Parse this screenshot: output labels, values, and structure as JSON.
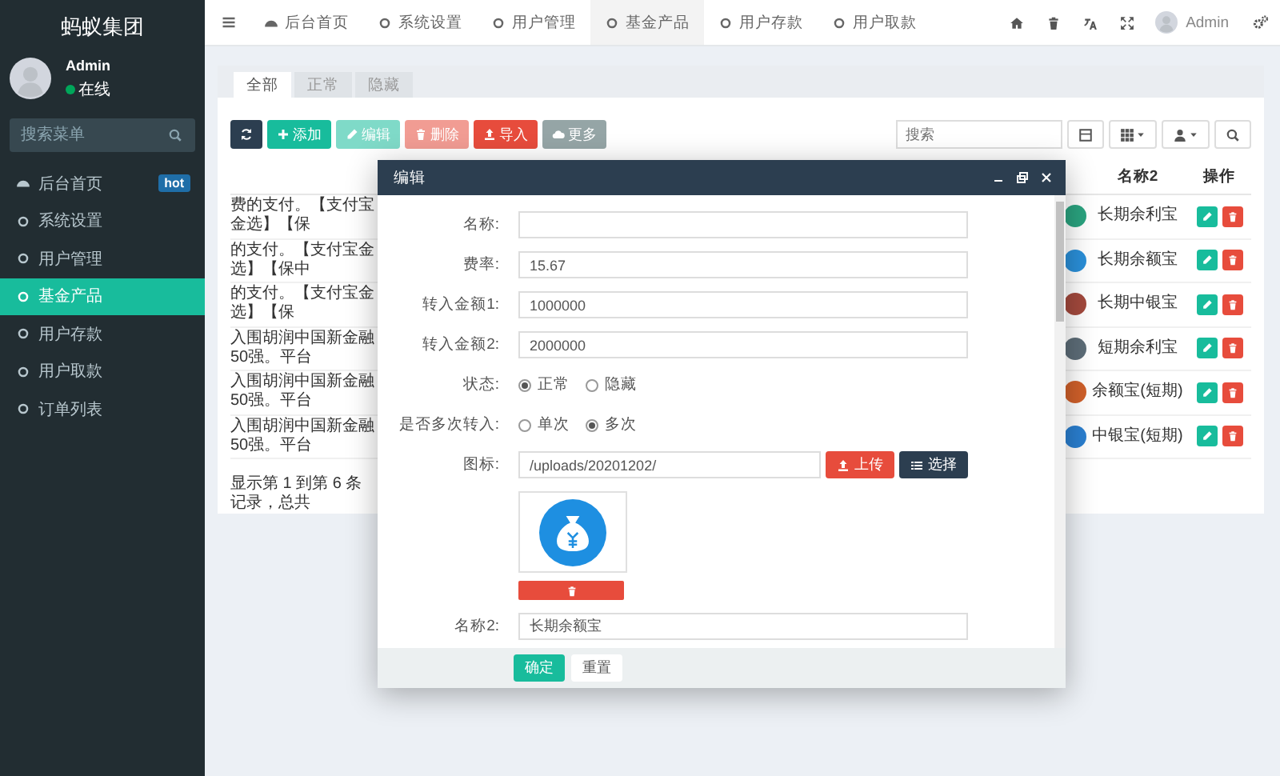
{
  "sidebar": {
    "brand": "蚂蚁集团",
    "user": {
      "name": "Admin",
      "status": "在线"
    },
    "search": {
      "placeholder": "搜索菜单"
    },
    "items": [
      {
        "label": "后台首页",
        "kind": "dashboard",
        "badge": "hot",
        "selected": false
      },
      {
        "label": "系统设置",
        "kind": "page",
        "selected": false
      },
      {
        "label": "用户管理",
        "kind": "page",
        "selected": false
      },
      {
        "label": "基金产品",
        "kind": "page",
        "selected": true
      },
      {
        "label": "用户存款",
        "kind": "page",
        "selected": false
      },
      {
        "label": "用户取款",
        "kind": "page",
        "selected": false
      },
      {
        "label": "订单列表",
        "kind": "page",
        "selected": false
      }
    ]
  },
  "topbar": {
    "tabs": [
      {
        "label": "后台首页",
        "kind": "dashboard",
        "selected": false
      },
      {
        "label": "系统设置",
        "kind": "page",
        "selected": false
      },
      {
        "label": "用户管理",
        "kind": "page",
        "selected": false
      },
      {
        "label": "基金产品",
        "kind": "page",
        "selected": true
      },
      {
        "label": "用户存款",
        "kind": "page",
        "selected": false
      },
      {
        "label": "用户取款",
        "kind": "page",
        "selected": false
      }
    ],
    "user": "Admin"
  },
  "panel": {
    "tabs": [
      {
        "label": "全部",
        "selected": true
      },
      {
        "label": "正常",
        "selected": false
      },
      {
        "label": "隐藏",
        "selected": false
      }
    ],
    "toolbar": [
      {
        "kind": "refresh",
        "disabled": false
      },
      {
        "kind": "add",
        "label": "添加",
        "disabled": false
      },
      {
        "kind": "edit",
        "label": "编辑",
        "disabled": true
      },
      {
        "kind": "delete",
        "label": "删除",
        "disabled": true
      },
      {
        "kind": "import",
        "label": "导入",
        "disabled": false
      },
      {
        "kind": "more",
        "label": "更多",
        "disabled": false
      }
    ],
    "search": {
      "placeholder": "搜索"
    },
    "table": {
      "columns": [
        "名称2",
        "操作"
      ],
      "rows": [
        {
          "text": "费的支付。【支付宝金选】【保",
          "color": "#2aa37f",
          "name2": "长期余利宝"
        },
        {
          "text": "的支付。【支付宝金选】【保中",
          "color": "#2a8fd8",
          "name2": "长期余额宝"
        },
        {
          "text": "的支付。【支付宝金选】【保",
          "color": "#a3493d",
          "name2": "长期中银宝"
        },
        {
          "text": "入围胡润中国新金融50强。平台",
          "color": "#5d6d78",
          "name2": "短期余利宝"
        },
        {
          "text": "入围胡润中国新金融50强。平台",
          "color": "#d0602a",
          "name2": "余额宝(短期)"
        },
        {
          "text": "入围胡润中国新金融50强。平台",
          "color": "#2a7fd0",
          "name2": "中银宝(短期)"
        }
      ]
    },
    "footer": "显示第 1 到第 6 条记录，总共"
  },
  "dialog": {
    "title": "编辑",
    "fields": [
      {
        "kind": "text",
        "label": "名称:"
      },
      {
        "kind": "text",
        "label": "费率:",
        "value": "15.67"
      },
      {
        "kind": "text",
        "label": "转入金额1:",
        "value": "1000000"
      },
      {
        "kind": "text",
        "label": "转入金额2:",
        "value": "2000000"
      },
      {
        "kind": "radio",
        "label": "状态:",
        "options": [
          {
            "label": "正常",
            "selected": true
          },
          {
            "label": "隐藏",
            "selected": false
          }
        ]
      },
      {
        "kind": "radio",
        "label": "是否多次转入:",
        "options": [
          {
            "label": "单次",
            "selected": false
          },
          {
            "label": "多次",
            "selected": true
          }
        ]
      },
      {
        "kind": "image",
        "label": "图标:",
        "value": "/uploads/20201202/",
        "buttons": [
          {
            "kind": "upload",
            "label": "上传"
          },
          {
            "kind": "choose",
            "label": "选择"
          }
        ]
      },
      {
        "kind": "text",
        "label": "名称2:",
        "value": "长期余额宝"
      }
    ],
    "buttons": [
      {
        "kind": "primary",
        "label": "确定"
      },
      {
        "kind": "default",
        "label": "重置"
      }
    ]
  }
}
